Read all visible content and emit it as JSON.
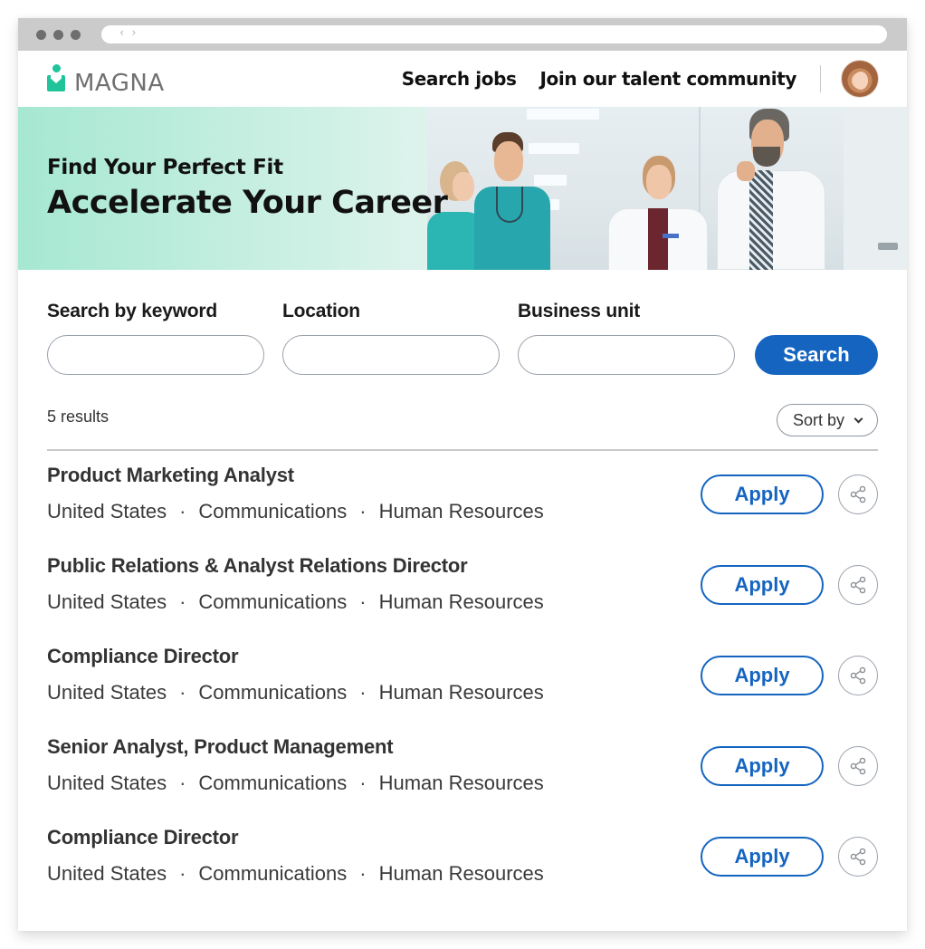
{
  "browser": {
    "nav_glyph": "‹ ›"
  },
  "header": {
    "logo_text": "MAGNA",
    "brand_color": "#21c39b",
    "nav": [
      {
        "label": "Search jobs"
      },
      {
        "label": "Join our talent community"
      }
    ],
    "avatar_icon": "user-avatar"
  },
  "hero": {
    "subtitle": "Find Your Perfect Fit",
    "title": "Accelerate Your Career",
    "image_alt": "Medical staff talking in a hospital corridor"
  },
  "search": {
    "fields": [
      {
        "label": "Search by keyword",
        "value": "",
        "placeholder": ""
      },
      {
        "label": "Location",
        "value": "",
        "placeholder": ""
      },
      {
        "label": "Business unit",
        "value": "",
        "placeholder": ""
      }
    ],
    "button_label": "Search",
    "accent_color": "#1565c0"
  },
  "results": {
    "count_label": "5 results",
    "sort_label": "Sort by"
  },
  "jobs": [
    {
      "title": "Product Marketing Analyst",
      "location": "United States",
      "department": "Communications",
      "function": "Human Resources",
      "apply_label": "Apply",
      "share_icon": "share-icon"
    },
    {
      "title": "Public Relations & Analyst Relations Director",
      "location": "United States",
      "department": "Communications",
      "function": "Human Resources",
      "apply_label": "Apply",
      "share_icon": "share-icon"
    },
    {
      "title": "Compliance Director",
      "location": "United States",
      "department": "Communications",
      "function": "Human Resources",
      "apply_label": "Apply",
      "share_icon": "share-icon"
    },
    {
      "title": "Senior Analyst, Product Management",
      "location": "United States",
      "department": "Communications",
      "function": "Human Resources",
      "apply_label": "Apply",
      "share_icon": "share-icon"
    },
    {
      "title": "Compliance Director",
      "location": "United States",
      "department": "Communications",
      "function": "Human Resources",
      "apply_label": "Apply",
      "share_icon": "share-icon"
    }
  ],
  "meta_separator": "·"
}
